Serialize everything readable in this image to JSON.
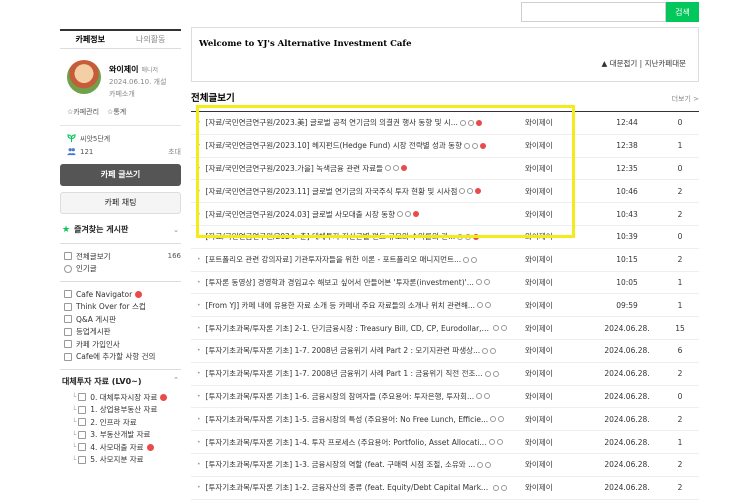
{
  "search": {
    "placeholder": "",
    "button_label": "검색"
  },
  "sidebar": {
    "tabs": [
      "카페정보",
      "나의활동"
    ],
    "cafe_name": "와이제이",
    "cafe_role": "매니저",
    "cafe_date": "2024.06.10. 개설",
    "cafe_intro": "카페소개",
    "links": [
      "☆카페관리",
      "☆통계"
    ],
    "level": "씨앗5단계",
    "members": "121",
    "invite": "초대",
    "write_button": "카페 글쓰기",
    "chat_button": "카페 채팅",
    "favorites_title": "즐겨찾는 게시판",
    "favorites_caret": "⌄",
    "menu": [
      {
        "label": "전체글보기",
        "count": "166"
      },
      {
        "label": "인기글",
        "count": ""
      }
    ],
    "menu2": [
      {
        "label": "Cafe Navigator"
      },
      {
        "label": "Think Over for 스컵"
      },
      {
        "label": "Q&A 게시판"
      },
      {
        "label": "등업게시판"
      },
      {
        "label": "카페 가입인사"
      },
      {
        "label": "Cafe에 추가할 사항 건의"
      }
    ],
    "category_title": "대체투자 자료 (LV0~)",
    "category_caret": "⌃",
    "category_items": [
      {
        "label": "0. 대체투자시장 자료"
      },
      {
        "label": "1. 상업용부동산 자료"
      },
      {
        "label": "2. 인프라 자료"
      },
      {
        "label": "3. 부동산개발 자료"
      },
      {
        "label": "4. 사모대출 자료"
      },
      {
        "label": "5. 사모지분 자료"
      }
    ]
  },
  "welcome": {
    "title": "Welcome to YJ's Alternative Investment Cafe",
    "links": "▲ 대문접기 | 지난카페대문"
  },
  "board": {
    "title": "전체글보기",
    "more": "더보기 >",
    "rows": [
      {
        "title": "[자료/국민연금연구원/2023.美] 글로벌 공적 연기금의 의결권 행사 동향 및 시...",
        "author": "와이제이",
        "date": "12:44",
        "views": "0",
        "red": true
      },
      {
        "title": "[자료/국민연금연구원/2023.10] 헤지펀드(Hedge Fund) 시장 전략별 성과 동향",
        "author": "와이제이",
        "date": "12:38",
        "views": "1",
        "red": true
      },
      {
        "title": "[자료/국민연금연구원/2023.가을] 녹색금융 관련 자료들",
        "author": "와이제이",
        "date": "12:35",
        "views": "0",
        "red": true
      },
      {
        "title": "[자료/국민연금연구원/2023.11] 글로벌 연기금의 자국주식 투자 현황 및 시사점",
        "author": "와이제이",
        "date": "10:46",
        "views": "2",
        "red": true
      },
      {
        "title": "[자료/국민연금연구원/2024.03] 글로벌 사모대출 시장 동향",
        "author": "와이제이",
        "date": "10:43",
        "views": "2",
        "red": true
      },
      {
        "title": "[자료/국민연금연구원/2024.-춘] 대체투자 자산군별 펀드 규모와 수익률의 관...",
        "author": "와이제이",
        "date": "10:39",
        "views": "0",
        "red": true
      },
      {
        "title": "[포트폴리오 관련 강의자료] 기관투자자들을 위한 이론 - 포트폴리오 매니지먼트...",
        "author": "와이제이",
        "date": "10:15",
        "views": "2",
        "red": false
      },
      {
        "title": "[투자론 동영상] 경영학과 경임교수 해보고 싶어서 만들어본 '투자론(investment)'...",
        "author": "와이제이",
        "date": "10:05",
        "views": "1",
        "red": false
      },
      {
        "title": "[From YJ] 카페 내에 유용한 자료 소개 등 카페내 주요 자료들의 소개나 위치 관련해...",
        "author": "와이제이",
        "date": "09:59",
        "views": "1",
        "red": false
      },
      {
        "title": "[투자기초과목/투자론 기초] 2-1. 단기금융시장 : Treasury Bill, CD, CP, Eurodollar, Re...",
        "author": "와이제이",
        "date": "2024.06.28.",
        "views": "15",
        "red": false
      },
      {
        "title": "[투자기초과목/투자론 기초] 1-7. 2008년 금융위기 사례 Part 2 : 모기지관련 파생상...",
        "author": "와이제이",
        "date": "2024.06.28.",
        "views": "6",
        "red": false
      },
      {
        "title": "[투자기초과목/투자론 기초] 1-7. 2008년 금융위기 사례 Part 1 : 금융위기 직전 전조...",
        "author": "와이제이",
        "date": "2024.06.28.",
        "views": "2",
        "red": false
      },
      {
        "title": "[투자기초과목/투자론 기초] 1-6. 금융시장의 참여자들 (주요용어: 투자은행, 투자회...",
        "author": "와이제이",
        "date": "2024.06.28.",
        "views": "0",
        "red": false
      },
      {
        "title": "[투자기초과목/투자론 기초] 1-5. 금융시장의 특성 (주요용어: No Free Lunch, Efficie...",
        "author": "와이제이",
        "date": "2024.06.28.",
        "views": "2",
        "red": false
      },
      {
        "title": "[투자기초과목/투자론 기초] 1-4. 투자 프로세스 (주요용어: Portfolio, Asset Allocati...",
        "author": "와이제이",
        "date": "2024.06.28.",
        "views": "1",
        "red": false
      },
      {
        "title": "[투자기초과목/투자론 기초] 1-3. 금융시장의 역할 (feat. 구매력 시점 조절, 소유와 ...",
        "author": "와이제이",
        "date": "2024.06.28.",
        "views": "2",
        "red": false
      },
      {
        "title": "[투자기초과목/투자론 기초] 1-2. 금융자산의 종류 (feat. Equity/Debt Capital Marke...",
        "author": "와이제이",
        "date": "2024.06.28.",
        "views": "2",
        "red": false
      }
    ]
  }
}
